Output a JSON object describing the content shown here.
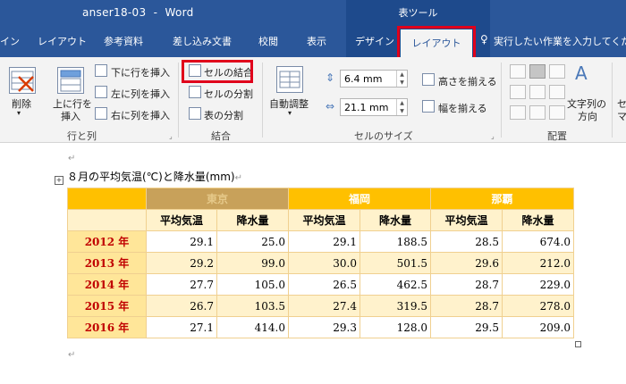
{
  "window": {
    "title": "anser18-03  -  Word",
    "tools_label": "表ツール"
  },
  "tabs": [
    {
      "label": "イン"
    },
    {
      "label": "レイアウト"
    },
    {
      "label": "参考資料"
    },
    {
      "label": "差し込み文書"
    },
    {
      "label": "校閲"
    },
    {
      "label": "表示"
    },
    {
      "label": "デザイン"
    }
  ],
  "active_tab": "レイアウト",
  "tell_me": "実行したい作業を入力してくださ",
  "ribbon": {
    "rows_cols": {
      "delete": "削除",
      "insert_above_1": "上に行を",
      "insert_above_2": "挿入",
      "insert_below": "下に行を挿入",
      "insert_left": "左に列を挿入",
      "insert_right": "右に列を挿入",
      "group": "行と列"
    },
    "merge": {
      "merge_cells": "セルの結合",
      "split_cells": "セルの分割",
      "split_table": "表の分割",
      "group": "結合"
    },
    "cell_size": {
      "autofit": "自動調整",
      "height": "6.4 mm",
      "width": "21.1 mm",
      "distribute_rows": "高さを揃える",
      "distribute_cols": "幅を揃える",
      "group": "セルのサイズ"
    },
    "alignment": {
      "text_direction_1": "文字列の",
      "text_direction_2": "方向",
      "cell_margins": "セ",
      "cell_margins_2": "マ",
      "group": "配置"
    }
  },
  "document": {
    "caption": "８月の平均気温(℃)と降水量(mm)",
    "pilcrow": "↵",
    "table": {
      "cities": [
        "東京",
        "福岡",
        "那覇"
      ],
      "subheaders": [
        "平均気温",
        "降水量",
        "平均気温",
        "降水量",
        "平均気温",
        "降水量"
      ],
      "rows": [
        {
          "year": "2012 年",
          "values": [
            "29.1",
            "25.0",
            "29.1",
            "188.5",
            "28.5",
            "674.0"
          ]
        },
        {
          "year": "2013 年",
          "values": [
            "29.2",
            "99.0",
            "30.0",
            "501.5",
            "29.6",
            "212.0"
          ]
        },
        {
          "year": "2014 年",
          "values": [
            "27.7",
            "105.0",
            "26.5",
            "462.5",
            "28.7",
            "229.0"
          ]
        },
        {
          "year": "2015 年",
          "values": [
            "26.7",
            "103.5",
            "27.4",
            "319.5",
            "28.7",
            "278.0"
          ]
        },
        {
          "year": "2016 年",
          "values": [
            "27.1",
            "414.0",
            "29.3",
            "128.0",
            "29.5",
            "209.0"
          ]
        }
      ]
    }
  }
}
